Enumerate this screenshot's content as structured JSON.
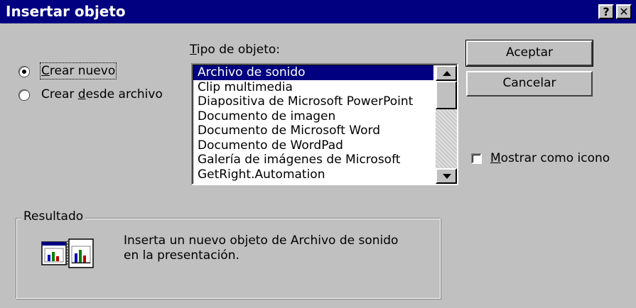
{
  "window": {
    "title": "Insertar objeto",
    "help_button": "?",
    "close_button": "✕"
  },
  "options": {
    "create_new_pre": "",
    "create_new_accel": "C",
    "create_new_post": "rear nuevo",
    "create_from_file_pre": "Crear ",
    "create_from_file_accel": "d",
    "create_from_file_post": "esde archivo",
    "selected": "create_new"
  },
  "object_type": {
    "label_accel": "T",
    "label_rest": "ipo de objeto:",
    "items": [
      "Archivo de sonido",
      "Clip multimedia",
      "Diapositiva de Microsoft PowerPoint",
      "Documento de imagen",
      "Documento de Microsoft Word",
      "Documento de WordPad",
      "Galería de imágenes de Microsoft",
      "GetRight.Automation"
    ],
    "selected_index": 0
  },
  "buttons": {
    "ok": "Aceptar",
    "cancel": "Cancelar"
  },
  "display_as_icon": {
    "label_accel": "M",
    "label_rest": "ostrar como icono",
    "checked": false
  },
  "result": {
    "legend": "Resultado",
    "line1": "Inserta un nuevo objeto de Archivo de sonido",
    "line2": "en la presentación."
  },
  "colors": {
    "face": "#c0c0c0",
    "titlebar": "#000080",
    "selection": "#000080"
  }
}
